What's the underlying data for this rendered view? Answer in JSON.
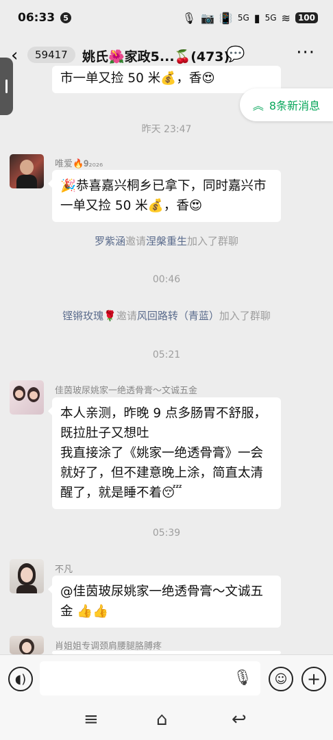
{
  "status_bar": {
    "time": "06:33",
    "notif_count": "5",
    "net1": "5G",
    "net2": "5G",
    "battery": "100"
  },
  "header": {
    "unread_count": "59417",
    "title": "姚氏🌺家政5...🍒(473)"
  },
  "new_messages": {
    "label": "8条新消息",
    "accent": "#07a65a"
  },
  "messages": {
    "top_partial": "市一单又捡 50 米💰，香😍",
    "time1": "昨天 23:47",
    "msg1": {
      "sender": "唯爱🔥𝟗₂₀₂₆",
      "text": "🎉恭喜嘉兴桐乡已拿下，同时嘉兴市一单又捡 50 米💰，香😍"
    },
    "sys1": {
      "name1": "罗紫涵",
      "verb": "邀请",
      "name2": "涅槃重生",
      "tail": "加入了群聊"
    },
    "time2": "00:46",
    "sys2": {
      "name1": "铿锵玫瑰🌹",
      "verb": "邀请",
      "name2": "风回路转（青蓝）",
      "tail": "加入了群聊"
    },
    "time3": "05:21",
    "msg2": {
      "sender": "佳茵玻尿姚家一绝透骨膏～文诚五金",
      "line1": "本人亲测，昨晚 9 点多肠胃不舒服，既拉肚子又想吐",
      "line2": "我直接涂了《姚家一绝透骨膏》一会就好了，但不建意晚上涂，简直太清醒了，就是睡不着😴"
    },
    "time4": "05:39",
    "msg3": {
      "sender": "不凡",
      "text": "@佳茵玻尿姚家一绝透骨膏～文诚五金 👍👍"
    },
    "msg4_sender": "肖姐姐专调颈肩腰腿胳膊疼"
  }
}
